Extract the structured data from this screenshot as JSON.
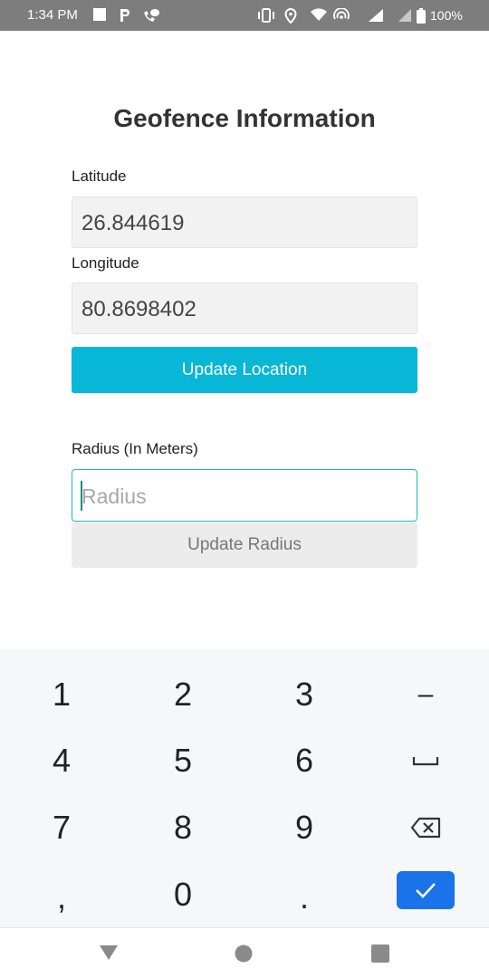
{
  "status_bar": {
    "time": "1:34 PM",
    "battery": "100%",
    "icons": [
      "stop-icon",
      "parking-icon",
      "phone-chat-icon",
      "vibrate-icon",
      "location-icon",
      "wifi-icon",
      "hotspot-icon",
      "signal-icon",
      "battery-icon"
    ]
  },
  "screen": {
    "title": "Geofence Information",
    "latitude": {
      "label": "Latitude",
      "value": "26.844619"
    },
    "longitude": {
      "label": "Longitude",
      "value": "80.8698402"
    },
    "update_location_label": "Update Location",
    "radius": {
      "label": "Radius (In Meters)",
      "placeholder": "Radius"
    },
    "update_radius_label": "Update Radius",
    "accent_color": "#08b6d6"
  },
  "keyboard": {
    "rows": [
      [
        "1",
        "2",
        "3",
        "-"
      ],
      [
        "4",
        "5",
        "6",
        "space"
      ],
      [
        "7",
        "8",
        "9",
        "backspace"
      ],
      [
        ",",
        "0",
        ".",
        "done"
      ]
    ],
    "keys": {
      "k1": "1",
      "k2": "2",
      "k3": "3",
      "minus": "–",
      "k4": "4",
      "k5": "5",
      "k6": "6",
      "k7": "7",
      "k8": "8",
      "k9": "9",
      "comma": ",",
      "k0": "0",
      "period": "."
    },
    "done_color": "#1a73e8"
  },
  "nav_bar": {
    "icons": [
      "back-icon",
      "home-icon",
      "recents-icon"
    ]
  }
}
